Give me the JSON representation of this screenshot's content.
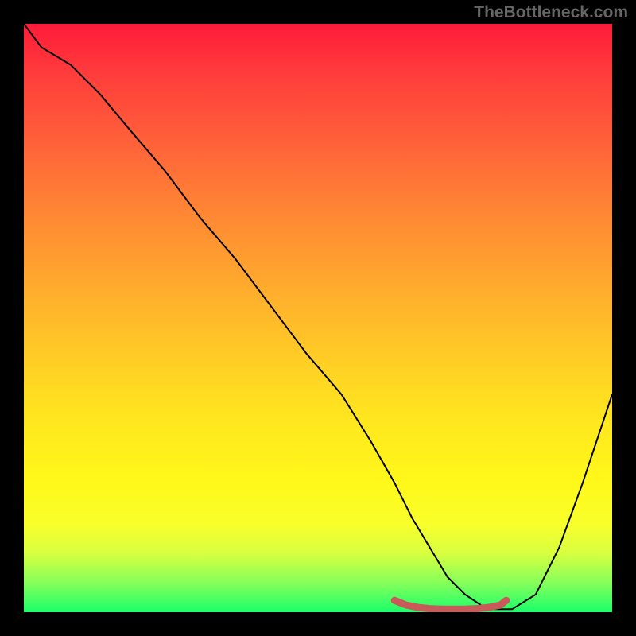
{
  "watermark": "TheBottleneck.com",
  "chart_data": {
    "type": "line",
    "title": "",
    "xlabel": "",
    "ylabel": "",
    "xlim": [
      0,
      100
    ],
    "ylim": [
      0,
      100
    ],
    "grid": false,
    "legend": false,
    "background_gradient": {
      "top_color": "#ff1a3a",
      "bottom_color": "#1aff6a",
      "description": "red-to-green vertical gradient (bottleneck severity, red=high, green=low)"
    },
    "series": [
      {
        "name": "bottleneck-curve",
        "color": "#000000",
        "x": [
          0,
          3,
          8,
          13,
          18,
          24,
          30,
          36,
          42,
          48,
          54,
          59,
          63,
          66,
          69,
          72,
          75,
          78,
          80,
          83,
          87,
          91,
          95,
          100
        ],
        "y": [
          100,
          96,
          93,
          88,
          82,
          75,
          67,
          60,
          52,
          44,
          37,
          29,
          22,
          16,
          11,
          6,
          3,
          1,
          0.5,
          0.5,
          3,
          11,
          22,
          37
        ]
      },
      {
        "name": "optimal-marker",
        "color": "#cc5a5a",
        "type": "scatter",
        "x": [
          63,
          65,
          67,
          69,
          71,
          73,
          75,
          77,
          79,
          81,
          82
        ],
        "y": [
          2,
          1.2,
          0.8,
          0.6,
          0.5,
          0.5,
          0.5,
          0.6,
          0.8,
          1.2,
          2
        ]
      }
    ],
    "interpretation": "Curve dips to minimum (optimal / no bottleneck) near x≈70-80, rising sharply either side indicating bottleneck percentage."
  }
}
